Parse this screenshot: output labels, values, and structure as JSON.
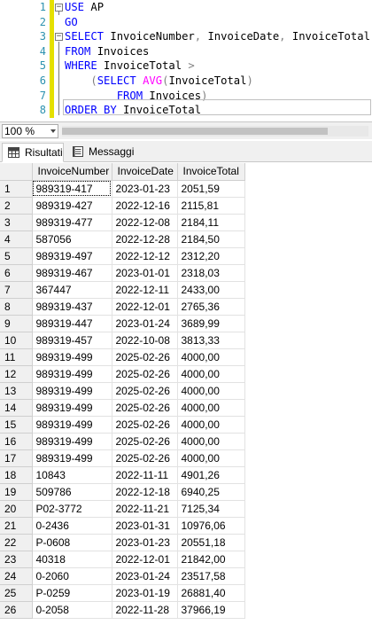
{
  "editor": {
    "lines": [
      {
        "number": "1",
        "tokens": [
          {
            "t": "USE",
            "c": "kw"
          },
          {
            "t": " AP",
            "c": "id"
          }
        ]
      },
      {
        "number": "2",
        "tokens": [
          {
            "t": "GO",
            "c": "kw"
          }
        ]
      },
      {
        "number": "3",
        "tokens": [
          {
            "t": "SELECT",
            "c": "kw"
          },
          {
            "t": " InvoiceNumber",
            "c": "id"
          },
          {
            "t": ",",
            "c": "op"
          },
          {
            "t": " InvoiceDate",
            "c": "id"
          },
          {
            "t": ",",
            "c": "op"
          },
          {
            "t": " InvoiceTotal",
            "c": "id"
          }
        ]
      },
      {
        "number": "4",
        "tokens": [
          {
            "t": "FROM",
            "c": "kw"
          },
          {
            "t": " Invoices",
            "c": "id"
          }
        ]
      },
      {
        "number": "5",
        "tokens": [
          {
            "t": "WHERE",
            "c": "kw"
          },
          {
            "t": " InvoiceTotal ",
            "c": "id"
          },
          {
            "t": ">",
            "c": "op"
          }
        ]
      },
      {
        "number": "6",
        "tokens": [
          {
            "t": "    ",
            "c": "id"
          },
          {
            "t": "(",
            "c": "op"
          },
          {
            "t": "SELECT",
            "c": "kw"
          },
          {
            "t": " ",
            "c": "id"
          },
          {
            "t": "AVG",
            "c": "fn"
          },
          {
            "t": "(",
            "c": "op"
          },
          {
            "t": "InvoiceTotal",
            "c": "id"
          },
          {
            "t": ")",
            "c": "op"
          }
        ]
      },
      {
        "number": "7",
        "tokens": [
          {
            "t": "        ",
            "c": "id"
          },
          {
            "t": "FROM",
            "c": "kw"
          },
          {
            "t": " Invoices",
            "c": "id"
          },
          {
            "t": ")",
            "c": "op"
          }
        ]
      },
      {
        "number": "8",
        "tokens": [
          {
            "t": "ORDER BY",
            "c": "kw"
          },
          {
            "t": " InvoiceTotal",
            "c": "id"
          }
        ]
      }
    ]
  },
  "zoom": {
    "value": "100 %"
  },
  "tabs": {
    "results": "Risultati",
    "messages": "Messaggi"
  },
  "grid": {
    "columns": [
      "InvoiceNumber",
      "InvoiceDate",
      "InvoiceTotal"
    ],
    "rows": [
      [
        "1",
        "989319-417",
        "2023-01-23",
        "2051,59"
      ],
      [
        "2",
        "989319-427",
        "2022-12-16",
        "2115,81"
      ],
      [
        "3",
        "989319-477",
        "2022-12-08",
        "2184,11"
      ],
      [
        "4",
        "587056",
        "2022-12-28",
        "2184,50"
      ],
      [
        "5",
        "989319-497",
        "2022-12-12",
        "2312,20"
      ],
      [
        "6",
        "989319-467",
        "2023-01-01",
        "2318,03"
      ],
      [
        "7",
        "367447",
        "2022-12-11",
        "2433,00"
      ],
      [
        "8",
        "989319-437",
        "2022-12-01",
        "2765,36"
      ],
      [
        "9",
        "989319-447",
        "2023-01-24",
        "3689,99"
      ],
      [
        "10",
        "989319-457",
        "2022-10-08",
        "3813,33"
      ],
      [
        "11",
        "989319-499",
        "2025-02-26",
        "4000,00"
      ],
      [
        "12",
        "989319-499",
        "2025-02-26",
        "4000,00"
      ],
      [
        "13",
        "989319-499",
        "2025-02-26",
        "4000,00"
      ],
      [
        "14",
        "989319-499",
        "2025-02-26",
        "4000,00"
      ],
      [
        "15",
        "989319-499",
        "2025-02-26",
        "4000,00"
      ],
      [
        "16",
        "989319-499",
        "2025-02-26",
        "4000,00"
      ],
      [
        "17",
        "989319-499",
        "2025-02-26",
        "4000,00"
      ],
      [
        "18",
        "10843",
        "2022-11-11",
        "4901,26"
      ],
      [
        "19",
        "509786",
        "2022-12-18",
        "6940,25"
      ],
      [
        "20",
        "P02-3772",
        "2022-11-21",
        "7125,34"
      ],
      [
        "21",
        "0-2436",
        "2023-01-31",
        "10976,06"
      ],
      [
        "22",
        "P-0608",
        "2023-01-23",
        "20551,18"
      ],
      [
        "23",
        "40318",
        "2022-12-01",
        "21842,00"
      ],
      [
        "24",
        "0-2060",
        "2023-01-24",
        "23517,58"
      ],
      [
        "25",
        "P-0259",
        "2023-01-19",
        "26881,40"
      ],
      [
        "26",
        "0-2058",
        "2022-11-28",
        "37966,19"
      ]
    ]
  }
}
